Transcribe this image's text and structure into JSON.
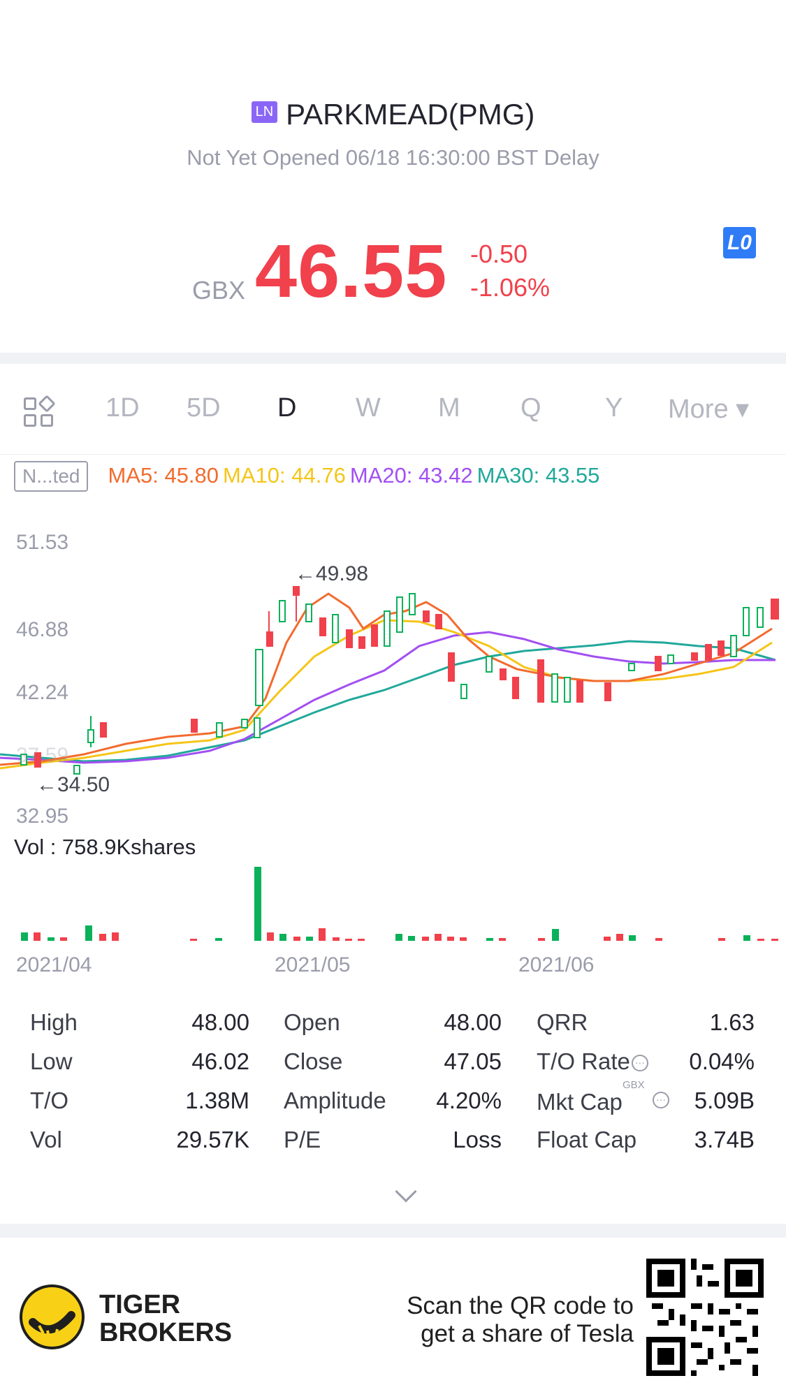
{
  "header": {
    "market_badge": "LN",
    "title": "PARKMEAD(PMG)",
    "status": "Not Yet Opened 06/18 16:30:00 BST Delay",
    "currency": "GBX",
    "price": "46.55",
    "change": "-0.50",
    "change_pct": "-1.06%",
    "lo_badge": "L0"
  },
  "tabs": [
    "1D",
    "5D",
    "D",
    "W",
    "M",
    "Q",
    "Y",
    "More ▾"
  ],
  "active_tab": "D",
  "indicators": {
    "box_label": "N...ted",
    "ma5": "MA5: 45.80",
    "ma10": "MA10: 44.76",
    "ma20": "MA20: 43.42",
    "ma30": "MA30: 43.55",
    "colors": {
      "ma5": "#f26b2e",
      "ma10": "#f5c518",
      "ma20": "#a24ff2",
      "ma30": "#21a89a",
      "up": "#0ab15a",
      "down": "#f0414c"
    }
  },
  "chart_data": {
    "type": "candlestick",
    "y_ticks": [
      "51.53",
      "46.88",
      "42.24",
      "37.59",
      "32.95"
    ],
    "ylim": [
      32.95,
      51.53
    ],
    "annotations": {
      "high": "←49.98",
      "low": "←34.50"
    },
    "x_labels": [
      "2021/04",
      "2021/05",
      "2021/06"
    ],
    "volume_label": "Vol  : 758.9Kshares"
  },
  "stats": {
    "rows": [
      [
        [
          "High",
          "48.00"
        ],
        [
          "Open",
          "48.00"
        ],
        [
          "QRR",
          "1.63"
        ]
      ],
      [
        [
          "Low",
          "46.02"
        ],
        [
          "Close",
          "47.05"
        ],
        [
          "T/O Rate",
          "0.04%"
        ]
      ],
      [
        [
          "T/O",
          "1.38M"
        ],
        [
          "Amplitude",
          "4.20%"
        ],
        [
          "Mkt Cap",
          "5.09B"
        ]
      ],
      [
        [
          "Vol",
          "29.57K"
        ],
        [
          "P/E",
          "Loss"
        ],
        [
          "Float Cap",
          "3.74B"
        ]
      ]
    ],
    "mktcap_unit": "GBX"
  },
  "footer": {
    "brand_line1": "TIGER",
    "brand_line2": "BROKERS",
    "promo_line1": "Scan the QR code to",
    "promo_line2": "get a share of Tesla"
  }
}
